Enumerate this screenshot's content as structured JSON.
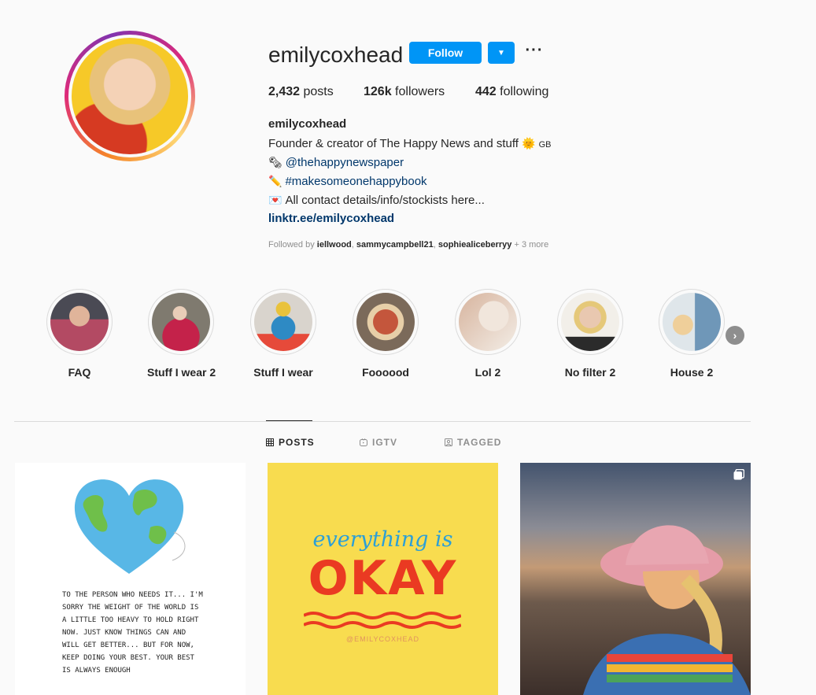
{
  "profile": {
    "username": "emilycoxhead",
    "follow_label": "Follow",
    "dropdown_icon": "caret-down-icon",
    "more_label": "···",
    "stats": {
      "posts_count": "2,432",
      "posts_label": " posts",
      "followers_count": "126k",
      "followers_label": " followers",
      "following_count": "442",
      "following_label": " following"
    },
    "bio": {
      "name": "emilycoxhead",
      "line1": "Founder & creator of The Happy News and stuff",
      "line1_emoji": "🌞",
      "line1_flag": "GB",
      "line2_emoji": "🗞",
      "line2_link": "@thehappynewspaper",
      "line3_emoji": "✏️",
      "line3_link": "#makesomeonehappybook",
      "line4_emoji": "💌",
      "line4_text": "All contact details/info/stockists here...",
      "url": "linktr.ee/emilycoxhead"
    },
    "followed_by": {
      "prefix": "Followed by ",
      "user1": "iellwood",
      "sep1": ", ",
      "user2": "sammycampbell21",
      "sep2": ", ",
      "user3": "sophiealiceberryy",
      "suffix": " + 3 more"
    }
  },
  "highlights": [
    {
      "label": "FAQ",
      "color": "#b34a63"
    },
    {
      "label": "Stuff I wear 2",
      "color": "#c4224a"
    },
    {
      "label": "Stuff I wear",
      "color": "#2e8ac4"
    },
    {
      "label": "Foooood",
      "color": "#c4563c"
    },
    {
      "label": "Lol 2",
      "color": "#e7d7c8"
    },
    {
      "label": "No filter 2",
      "color": "#d9bea6"
    },
    {
      "label": "House 2",
      "color": "#6f97b8"
    }
  ],
  "tabs": [
    {
      "label": "POSTS",
      "icon": "grid-icon",
      "active": true
    },
    {
      "label": "IGTV",
      "icon": "igtv-icon",
      "active": false
    },
    {
      "label": "TAGGED",
      "icon": "tagged-icon",
      "active": false
    }
  ],
  "posts": {
    "post1_text": "To the person who needs it... I'm sorry the weight of the world is a little too heavy to hold right now. Just know things can and will get better... but for now, keep doing your best. Your best is always enough",
    "post2_top": "everything is",
    "post2_main": "OKAY",
    "post2_handle": "@EMILYCOXHEAD"
  },
  "colors": {
    "accent": "#0095f6",
    "link": "#00376b",
    "muted": "#8e8e8e"
  }
}
